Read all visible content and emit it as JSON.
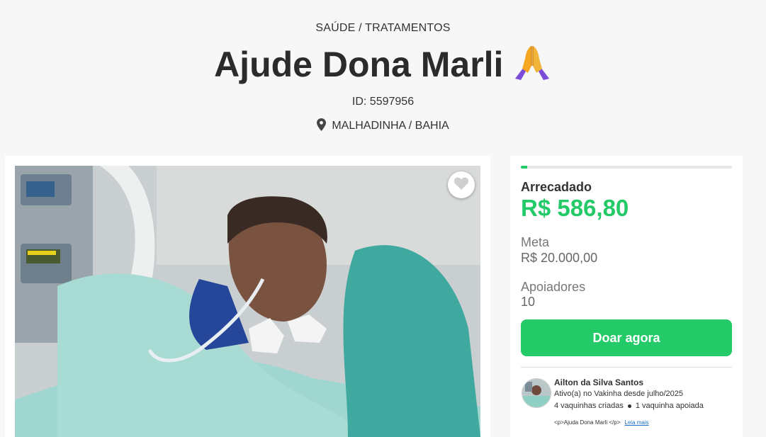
{
  "header": {
    "category": "SAÚDE / TRATAMENTOS",
    "title": "Ajude Dona Marli",
    "title_emoji_icon": "praying-hands-icon",
    "campaign_id": "ID: 5597956",
    "location": "MALHADINHA / BAHIA",
    "location_icon": "map-pin-icon"
  },
  "media": {
    "favorite_icon": "heart-icon"
  },
  "stats": {
    "progress_fraction": 0.029,
    "raised_label": "Arrecadado",
    "raised_value": "R$ 586,80",
    "goal_label": "Meta",
    "goal_value": "R$ 20.000,00",
    "supporters_label": "Apoiadores",
    "supporters_value": "10",
    "donate_label": "Doar agora"
  },
  "creator": {
    "name": "Ailton da Silva Santos",
    "since": "Ativo(a) no Vakinha desde julho/2025",
    "created": "4 vaquinhas criadas",
    "supported": "1 vaquinha apoiada",
    "excerpt": "<p>Ajuda Dona Marli </p>",
    "read_more": "Leia mais"
  },
  "colors": {
    "brand_green": "#24ca68",
    "background": "#f7f7f7",
    "link_blue": "#1a73c8"
  }
}
